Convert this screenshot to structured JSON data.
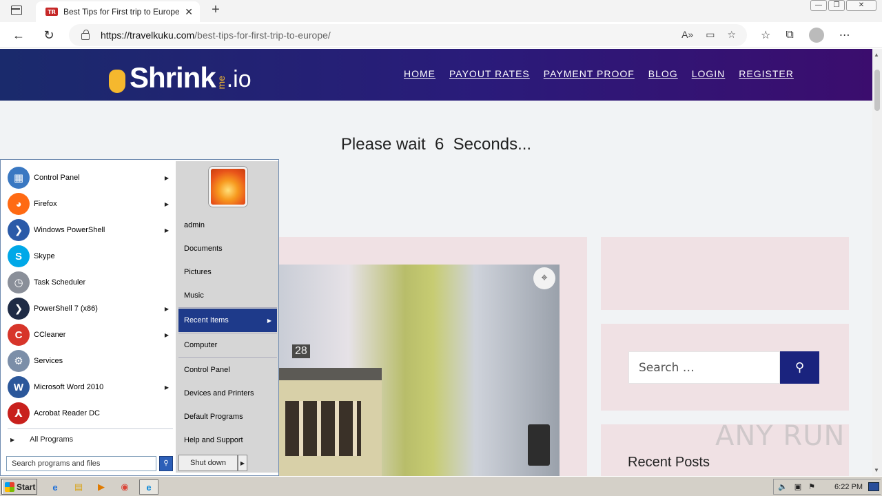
{
  "browser": {
    "tab_title": "Best Tips for First trip to Europe",
    "tab_favicon_text": "TR",
    "url_domain": "https://travelkuku.com",
    "url_path": "/best-tips-for-first-trip-to-europe/",
    "icons": [
      "sidebar-icon",
      "back-icon",
      "refresh-icon",
      "lock-icon",
      "read-aloud-icon",
      "immersive-reader-icon",
      "add-favorite-icon",
      "favorites-icon",
      "collections-icon",
      "profile-icon",
      "more-icon"
    ]
  },
  "site": {
    "logo_word": "Shrink",
    "logo_me": "me",
    "logo_io": ".io",
    "nav": [
      "HOME",
      "PAYOUT RATES",
      "PAYMENT PROOF",
      "BLOG",
      "LOGIN",
      "REGISTER"
    ],
    "wait_text": "Please wait  6  Seconds...",
    "photo_tram_number": "28",
    "search_placeholder": "Search …",
    "recent_posts_title": "Recent Posts",
    "watermark": "ANY RUN"
  },
  "start_menu": {
    "programs": [
      {
        "label": "Control Panel",
        "icon": "control-panel-icon",
        "has_arrow": true,
        "color": "#3a78c2"
      },
      {
        "label": "Firefox",
        "icon": "firefox-icon",
        "has_arrow": true,
        "color": "#ff6a13"
      },
      {
        "label": "Windows PowerShell",
        "icon": "powershell-icon",
        "has_arrow": true,
        "color": "#2a5aa8"
      },
      {
        "label": "Skype",
        "icon": "skype-icon",
        "has_arrow": false,
        "color": "#00a8e8"
      },
      {
        "label": "Task Scheduler",
        "icon": "task-scheduler-icon",
        "has_arrow": false,
        "color": "#8a8f99"
      },
      {
        "label": "PowerShell 7 (x86)",
        "icon": "powershell7-icon",
        "has_arrow": true,
        "color": "#1e2b45"
      },
      {
        "label": "CCleaner",
        "icon": "ccleaner-icon",
        "has_arrow": true,
        "color": "#d7352a"
      },
      {
        "label": "Services",
        "icon": "services-icon",
        "has_arrow": false,
        "color": "#7b8ea8"
      },
      {
        "label": "Microsoft Word 2010",
        "icon": "word-icon",
        "has_arrow": true,
        "color": "#2b579a"
      },
      {
        "label": "Acrobat Reader DC",
        "icon": "acrobat-icon",
        "has_arrow": false,
        "color": "#c8201c"
      }
    ],
    "all_programs": "All Programs",
    "search_placeholder": "Search programs and files",
    "right_items": [
      {
        "label": "admin",
        "active": false,
        "arrow": false
      },
      {
        "label": "Documents",
        "active": false,
        "arrow": false
      },
      {
        "label": "Pictures",
        "active": false,
        "arrow": false
      },
      {
        "label": "Music",
        "active": false,
        "arrow": false
      },
      {
        "label": "Recent Items",
        "active": true,
        "arrow": true
      },
      {
        "label": "Computer",
        "active": false,
        "arrow": false
      },
      {
        "label": "Control Panel",
        "active": false,
        "arrow": false
      },
      {
        "label": "Devices and Printers",
        "active": false,
        "arrow": false
      },
      {
        "label": "Default Programs",
        "active": false,
        "arrow": false
      },
      {
        "label": "Help and Support",
        "active": false,
        "arrow": false
      }
    ],
    "shutdown_label": "Shut down"
  },
  "taskbar": {
    "start_label": "Start",
    "apps": [
      "ie-icon",
      "explorer-icon",
      "media-player-icon",
      "chrome-icon",
      "edge-icon"
    ],
    "clock": "6:22 PM"
  }
}
